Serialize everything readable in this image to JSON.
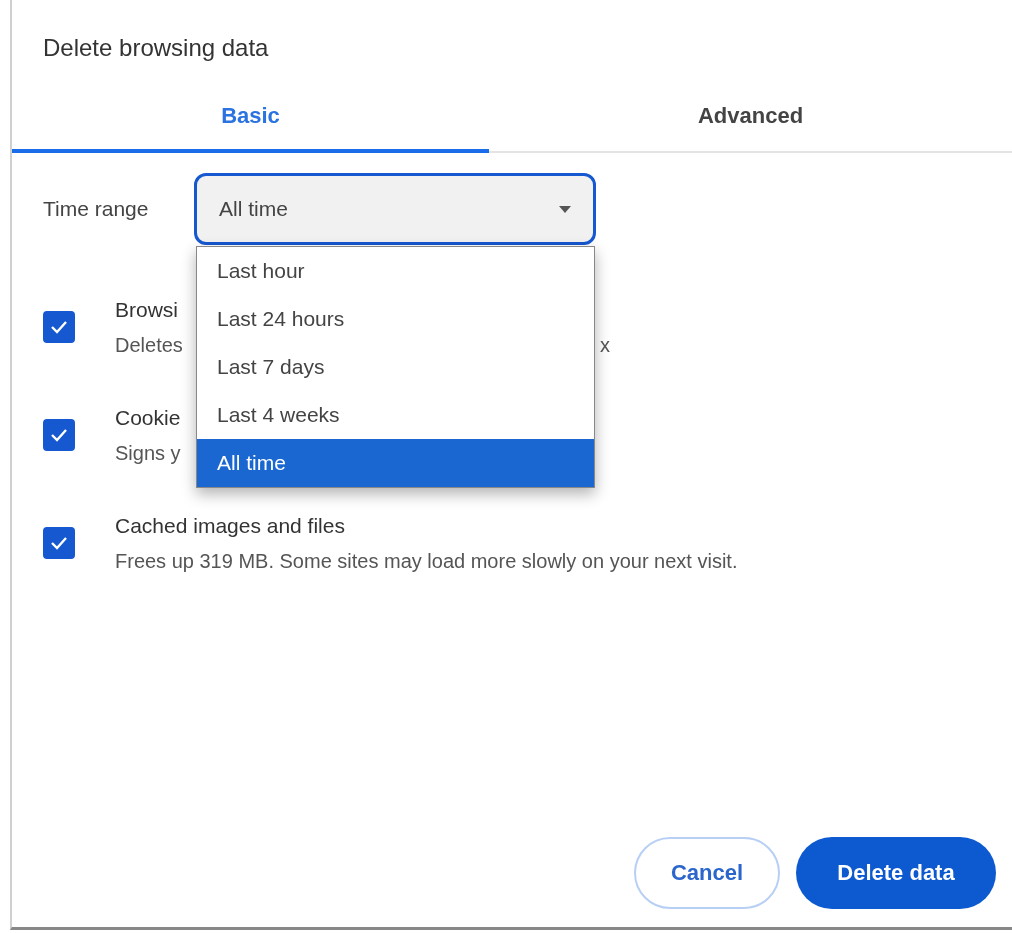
{
  "dialog": {
    "title": "Delete browsing data"
  },
  "tabs": [
    {
      "label": "Basic",
      "selected": true
    },
    {
      "label": "Advanced",
      "selected": false
    }
  ],
  "time_range": {
    "label": "Time range",
    "value": "All time",
    "expanded": true,
    "options": [
      {
        "label": "Last hour",
        "selected": false
      },
      {
        "label": "Last 24 hours",
        "selected": false
      },
      {
        "label": "Last 7 days",
        "selected": false
      },
      {
        "label": "Last 4 weeks",
        "selected": false
      },
      {
        "label": "All time",
        "selected": true
      }
    ]
  },
  "items": [
    {
      "title": "Browsi",
      "description": "Deletes",
      "description_tail": "x",
      "checked": true
    },
    {
      "title": "Cookie",
      "description": "Signs y",
      "checked": true
    },
    {
      "title": "Cached images and files",
      "description": "Frees up 319 MB. Some sites may load more slowly on your next visit.",
      "checked": true
    }
  ],
  "buttons": [
    {
      "label": "Cancel",
      "kind": "secondary"
    },
    {
      "label": "Delete data",
      "kind": "primary"
    }
  ]
}
